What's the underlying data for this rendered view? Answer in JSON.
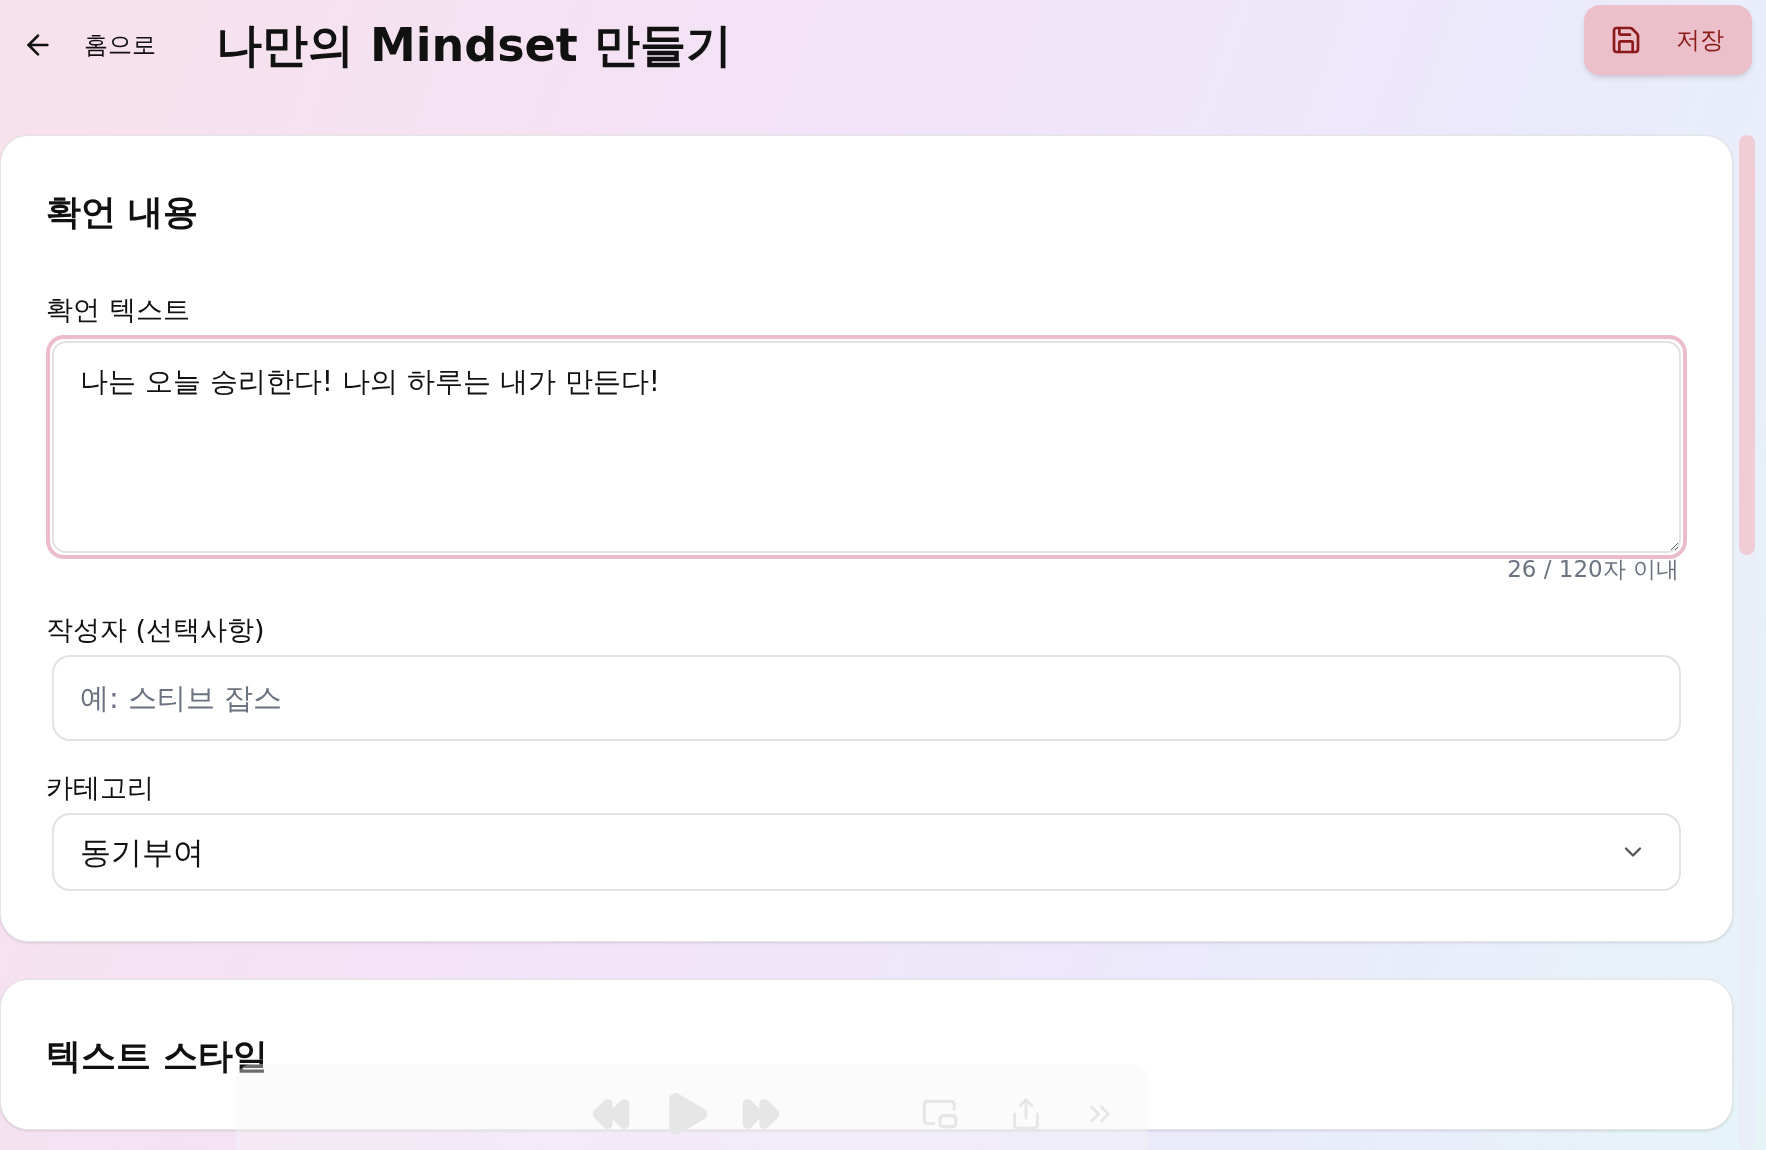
{
  "header": {
    "back_label": "홈으로",
    "title": "나만의 Mindset 만들기",
    "save_label": "저장"
  },
  "sections": [
    {
      "title": "확언 내용",
      "fields": [
        {
          "kind": "textarea",
          "label": "확언 텍스트",
          "value": "나는 오늘 승리한다! 나의 하루는 내가 만든다!",
          "focused": true,
          "counter": "26 / 120자 이내"
        },
        {
          "kind": "input",
          "label": "작성자 (선택사항)",
          "placeholder": "예: 스티브 잡스"
        },
        {
          "kind": "select",
          "label": "카테고리",
          "value": "동기부여"
        }
      ]
    },
    {
      "title": "텍스트 스타일"
    }
  ]
}
